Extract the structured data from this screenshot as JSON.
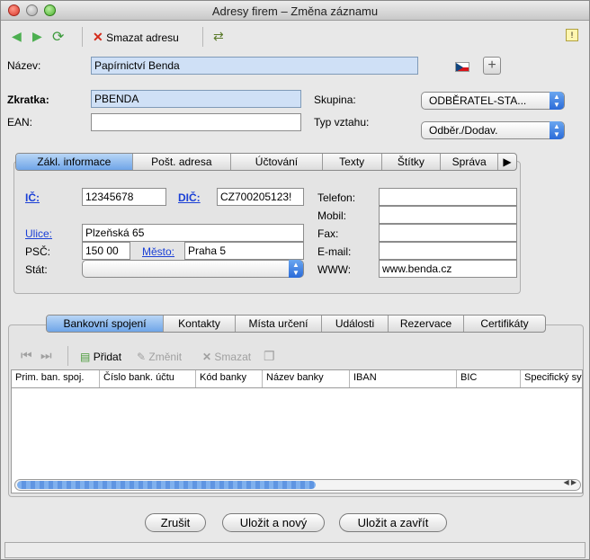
{
  "window": {
    "title": "Adresy firem – Změna záznamu"
  },
  "toolbar": {
    "delete_label": "Smazat adresu"
  },
  "form": {
    "nazev_label": "Název:",
    "nazev_value": "Papírnictví Benda",
    "zkratka_label": "Zkratka:",
    "zkratka_value": "PBENDA",
    "ean_label": "EAN:",
    "ean_value": "",
    "skupina_label": "Skupina:",
    "skupina_value": "ODBĚRATEL-STA...",
    "typ_label": "Typ vztahu:",
    "typ_value": "Odběr./Dodav."
  },
  "top_tabs": [
    "Zákl. informace",
    "Pošt. adresa",
    "Účtování",
    "Texty",
    "Štítky",
    "Správa"
  ],
  "info": {
    "ic_label": "IČ:",
    "ic_value": "12345678",
    "dic_label": "DIČ:",
    "dic_value": "CZ700205123!",
    "ulice_label": "Ulice:",
    "ulice_value": "Plzeňská 65",
    "psc_label": "PSČ:",
    "psc_value": "150 00",
    "mesto_label": "Město:",
    "mesto_value": "Praha 5",
    "stat_label": "Stát:",
    "stat_value": "",
    "telefon_label": "Telefon:",
    "telefon_value": "",
    "mobil_label": "Mobil:",
    "mobil_value": "",
    "fax_label": "Fax:",
    "fax_value": "",
    "email_label": "E-mail:",
    "email_value": "",
    "www_label": "WWW:",
    "www_value": "www.benda.cz"
  },
  "bottom_tabs": [
    "Bankovní spojení",
    "Kontakty",
    "Místa určení",
    "Události",
    "Rezervace",
    "Certifikáty"
  ],
  "bank_toolbar": {
    "add": "Přidat",
    "edit": "Změnit",
    "delete": "Smazat"
  },
  "bank_columns": [
    "Prim. ban. spoj.",
    "Číslo bank. účtu",
    "Kód banky",
    "Název banky",
    "IBAN",
    "BIC",
    "Specifický sy"
  ],
  "buttons": {
    "cancel": "Zrušit",
    "save_new": "Uložit a nový",
    "save_close": "Uložit a zavřít"
  }
}
